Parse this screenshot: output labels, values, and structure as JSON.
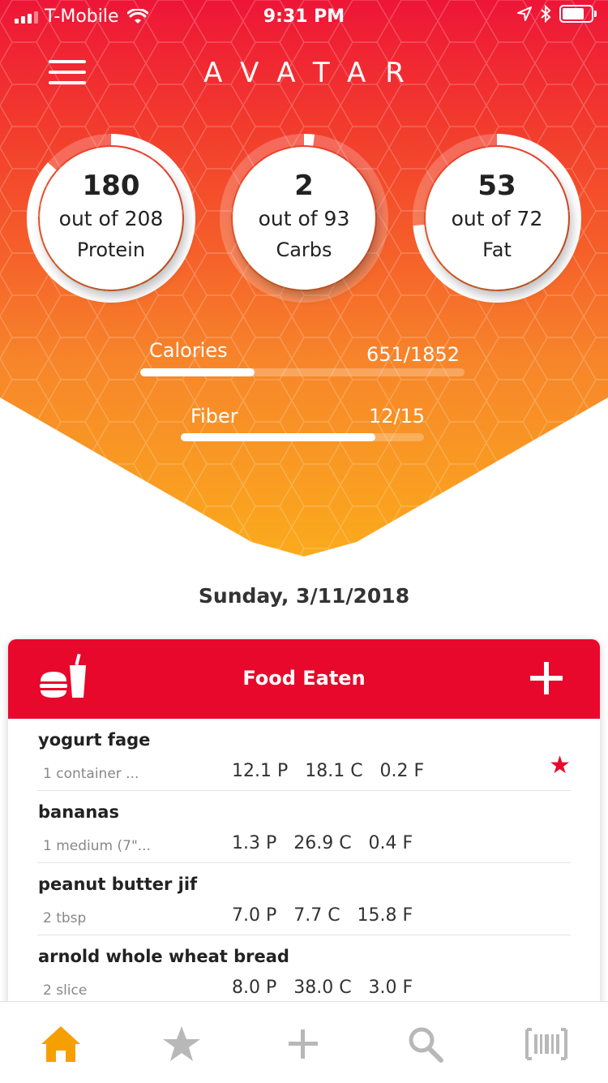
{
  "status_bar": {
    "carrier": "T-Mobile",
    "time": "9:31 PM"
  },
  "header": {
    "brand": "AVATAR"
  },
  "macros": [
    {
      "name": "Protein",
      "value": "180",
      "subtitle": "out of 208",
      "progress": 0.865
    },
    {
      "name": "Carbs",
      "value": "2",
      "subtitle": "out of 93",
      "progress": 0.02
    },
    {
      "name": "Fat",
      "value": "53",
      "subtitle": "out of 72",
      "progress": 0.736
    }
  ],
  "calories": {
    "label": "Calories",
    "value": "651/1852",
    "progress": 0.352
  },
  "fiber": {
    "label": "Fiber",
    "value": "12/15",
    "progress": 0.8
  },
  "date": "Sunday, 3/11/2018",
  "food_card": {
    "title": "Food Eaten",
    "items": [
      {
        "name": "yogurt fage",
        "serving": "1 container ...",
        "macros": "12.1 P   18.1 C   0.2 F",
        "favorite": true
      },
      {
        "name": "bananas",
        "serving": "1 medium (7\"...",
        "macros": "1.3 P   26.9 C   0.4 F",
        "favorite": false
      },
      {
        "name": "peanut butter jif",
        "serving": "2 tbsp",
        "macros": "7.0 P   7.7 C   15.8 F",
        "favorite": false
      },
      {
        "name": "arnold whole wheat bread",
        "serving": "2 slice",
        "macros": "8.0 P   38.0 C   3.0 F",
        "favorite": false
      }
    ]
  },
  "tab_bar": {
    "tabs": [
      "home-icon",
      "star-icon",
      "plus-icon",
      "search-icon",
      "barcode-icon"
    ],
    "active_color": "#f5a000",
    "inactive_color": "#b8b8b8"
  },
  "colors": {
    "brand_red": "#e8082c",
    "accent_orange": "#fbab1c"
  }
}
